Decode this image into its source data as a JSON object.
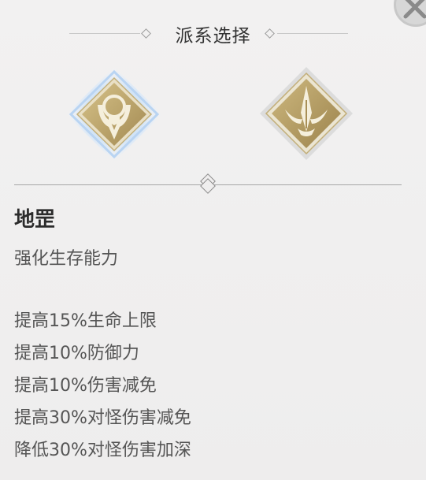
{
  "header": {
    "title": "派系选择"
  },
  "close_button": {
    "icon": "close-icon"
  },
  "factions": [
    {
      "icon": "shield-emblem-icon",
      "selected": true
    },
    {
      "icon": "trident-emblem-icon",
      "selected": false
    }
  ],
  "detail": {
    "name": "地罡",
    "description": "强化生存能力",
    "effects": [
      "提高15%生命上限",
      "提高10%防御力",
      "提高10%伤害减免",
      "提高30%对怪伤害减免",
      "降低30%对怪伤害加深"
    ]
  },
  "colors": {
    "background": "#efeeee",
    "gold": "#b9a36e",
    "selected_glow": "#bcd8f5",
    "text_primary": "#2c2c2c",
    "text_secondary": "#555555"
  }
}
